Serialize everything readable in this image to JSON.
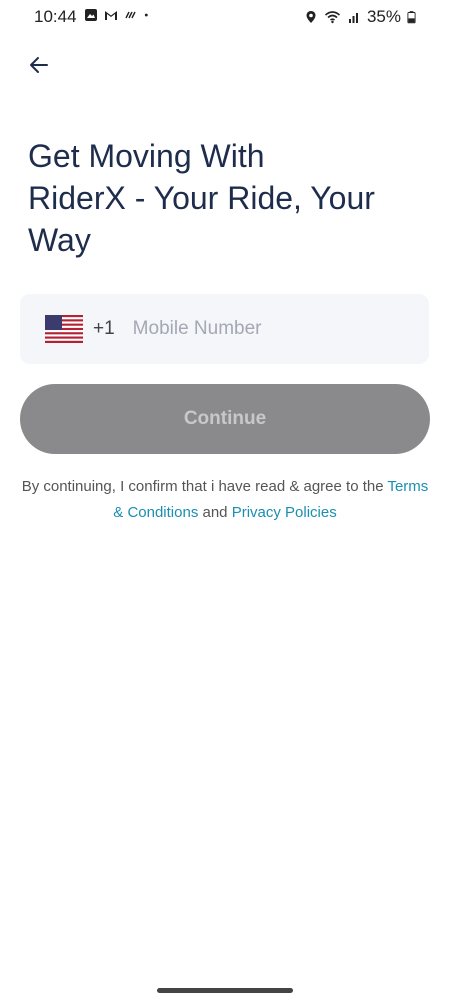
{
  "status_bar": {
    "time": "10:44",
    "battery": "35%",
    "icons": [
      "image-icon",
      "gmail-icon",
      "signal-scribble-icon",
      "dot-icon",
      "location-icon",
      "wifi-icon",
      "cell-signal-icon",
      "battery-icon"
    ]
  },
  "header": {
    "back_icon": "back-arrow-icon",
    "headline": "Get Moving With\nRiderX  - Your Ride, Your\nWay"
  },
  "phone": {
    "country_flag": "us-flag-icon",
    "dial_code": "+1",
    "value": "",
    "placeholder": "Mobile Number"
  },
  "continue_button": {
    "label": "Continue",
    "disabled": true,
    "bg_color": "#8a8a8c"
  },
  "legal": {
    "prefix": "By continuing, I confirm that i have read & agree to the",
    "terms": "Terms & Conditions",
    "and": "and",
    "privacy": "Privacy Policies",
    "link_color": "#1b8fb0"
  },
  "colors": {
    "headline": "#1f2d4d",
    "field_bg": "#f5f6fa"
  }
}
